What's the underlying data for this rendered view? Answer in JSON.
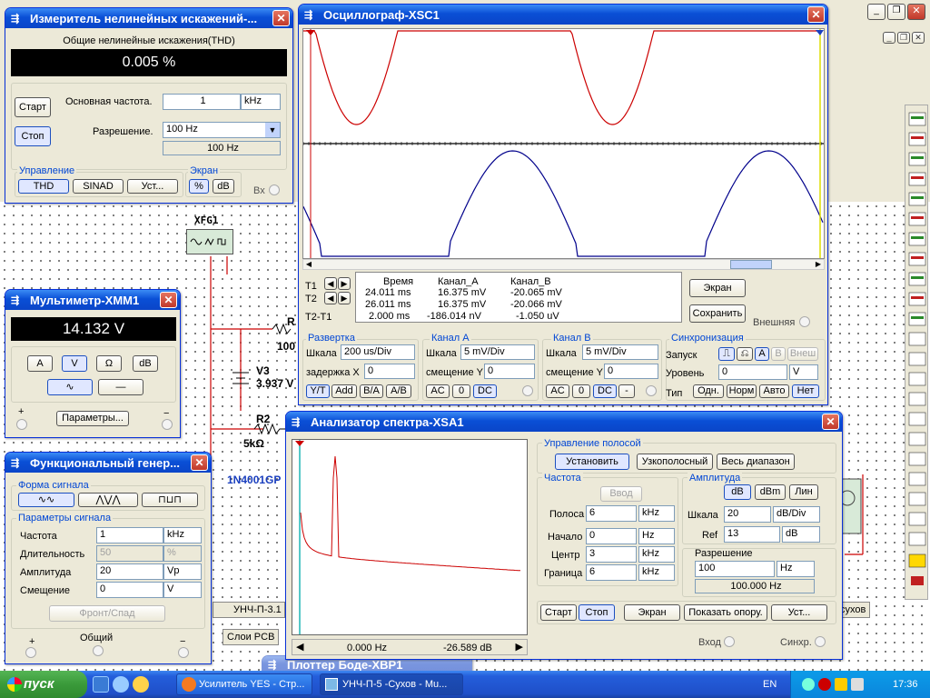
{
  "distortion": {
    "title": "Измеритель нелинейных искажений-...",
    "thd_header": "Общие нелинейные искажения(THD)",
    "display": "0.005 %",
    "start": "Старт",
    "stop": "Стоп",
    "freq_label": "Основная частота.",
    "freq_value": "1",
    "freq_unit": "kHz",
    "res_label": "Разрешение.",
    "res_value": "100 Hz",
    "res_readout": "100 Hz",
    "control_group": "Управление",
    "thd": "THD",
    "sinad": "SINAD",
    "settings": "Уст...",
    "screen_group": "Экран",
    "percent": "%",
    "db": "dB",
    "bx": "Вх"
  },
  "osc": {
    "title": "Осциллограф-XSC1",
    "cursor_headers": [
      "Время",
      "Канал_A",
      "Канал_B"
    ],
    "rows": [
      {
        "label": "T1",
        "time": "24.011 ms",
        "a": "16.375 mV",
        "b": "-20.065 mV"
      },
      {
        "label": "T2",
        "time": "26.011 ms",
        "a": "16.375 mV",
        "b": "-20.066 mV"
      },
      {
        "label": "T2-T1",
        "time": "2.000 ms",
        "a": "-186.014 nV",
        "b": "-1.050 uV"
      }
    ],
    "screen_btn": "Экран",
    "save_btn": "Сохранить",
    "external": "Внешняя",
    "sweep": {
      "title": "Развертка",
      "scale_label": "Шкала",
      "scale": "200 us/Div",
      "delay_label": "задержка X",
      "delay": "0",
      "buttons": [
        "Y/T",
        "Add",
        "B/A",
        "A/B"
      ]
    },
    "cha": {
      "title": "Канал А",
      "scale_label": "Шкала",
      "scale": "5 mV/Div",
      "offset_label": "смещение Y",
      "offset": "0",
      "buttons": [
        "AC",
        "0",
        "DC"
      ]
    },
    "chb": {
      "title": "Канал B",
      "scale_label": "Шкала",
      "scale": "5 mV/Div",
      "offset_label": "смещение Y",
      "offset": "0",
      "buttons": [
        "AC",
        "0",
        "DC",
        "-"
      ]
    },
    "trig": {
      "title": "Синхронизация",
      "launch_label": "Запуск",
      "level_label": "Уровень",
      "level": "0",
      "level_unit": "V",
      "type_label": "Тип",
      "src": [
        "A",
        "B",
        "Внеш"
      ],
      "types": [
        "Одн.",
        "Норм",
        "Авто",
        "Нет"
      ]
    },
    "colors": {
      "channel_a": "#cc0000",
      "channel_b": "#00008b",
      "cursor1": "#cc0000",
      "cursor2": "#1a3fbf"
    }
  },
  "mm": {
    "title": "Мультиметр-XMM1",
    "display": "14.132 V",
    "modes": [
      "A",
      "V",
      "Ω",
      "dB"
    ],
    "params": "Параметры...",
    "plus": "+",
    "minus": "−"
  },
  "fg": {
    "title": "Функциональный генер...",
    "wave_group": "Форма сигнала",
    "params_group": "Параметры сигнала",
    "rows": [
      {
        "label": "Частота",
        "value": "1",
        "unit": "kHz"
      },
      {
        "label": "Длительность",
        "value": "50",
        "unit": "%"
      },
      {
        "label": "Амплитуда",
        "value": "20",
        "unit": "Vp"
      },
      {
        "label": "Смещение",
        "value": "0",
        "unit": "V"
      }
    ],
    "edge_btn": "Фронт/Спад",
    "plus": "+",
    "common": "Общий",
    "minus": "−"
  },
  "sa": {
    "title": "Анализатор спектра-XSA1",
    "band_group": "Управление полосой",
    "set_btn": "Установить",
    "narrow_btn": "Узкополосный",
    "full_btn": "Весь диапазон",
    "freq_group": "Частота",
    "enter_btn": "Ввод",
    "band_label": "Полоса",
    "band": "6",
    "band_unit": "kHz",
    "start_label": "Начало",
    "start": "0",
    "start_unit": "Hz",
    "center_label": "Центр",
    "center": "3",
    "center_unit": "kHz",
    "end_label": "Граница",
    "end": "6",
    "end_unit": "kHz",
    "amp_group": "Амплитуда",
    "amp_modes": [
      "dB",
      "dBm",
      "Лин"
    ],
    "scale_label": "Шкала",
    "scale": "20",
    "scale_unit": "dB/Div",
    "ref_label": "Ref",
    "ref": "13",
    "ref_unit": "dB",
    "res_group": "Разрешение",
    "res_value": "100",
    "res_unit": "Hz",
    "res_readout": "100.000 Hz",
    "start_btn": "Старт",
    "stop_btn": "Стоп",
    "screen_btn": "Экран",
    "ref_btn": "Показать опору.",
    "settings_btn": "Уст...",
    "readout_freq": "0.000  Hz",
    "readout_db": "-26.589  dB",
    "input": "Вход",
    "sync": "Синхр.",
    "trace_color": "#cc0000"
  },
  "circuit": {
    "xfg": "XFG1",
    "r1": "R",
    "r1_val": "100",
    "v3": "V3",
    "v3_val": "3.937 V",
    "r2": "R2",
    "r2_val": "5kΩ",
    "diode": "1N4001GP",
    "tab": "УНЧ-П-3.1",
    "tab2": "сухов",
    "pcb": "Слои PCB",
    "plotter": "Плоттер Боде-XBP1"
  },
  "taskbar": {
    "start": "пуск",
    "tasks": [
      "Усилитель YES - Стр...",
      "УНЧ-П-5 -Сухов - Mu..."
    ],
    "lang": "EN",
    "clock": "17:36"
  }
}
